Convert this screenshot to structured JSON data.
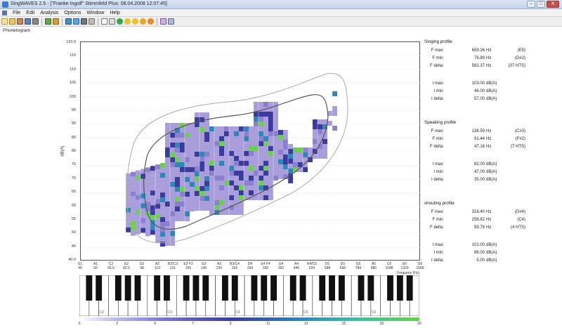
{
  "window": {
    "title": "SingWAVES 2.5 - [\"Franke Ingolf\" Stimmfeld Plus: 08.04.2008 12:07:45]",
    "min_label": "–",
    "max_label": "□",
    "close_label": "X"
  },
  "menu": [
    "File",
    "Edit",
    "Analysis",
    "Options",
    "Window",
    "Help"
  ],
  "panel": {
    "title": "Phonetogram"
  },
  "chart_data": {
    "type": "heatmap",
    "ylabel": "dB(A)",
    "xlabel": "Frequenz (Hz)",
    "y_ticks": [
      "120.0",
      "115",
      "110",
      "105",
      "100",
      "95",
      "90",
      "85",
      "80",
      "75",
      "70",
      "65",
      "60",
      "55",
      "50",
      "45",
      "40.0"
    ],
    "x_notes": [
      {
        "note": "G1",
        "hz": "49"
      },
      {
        "note": "A1",
        "hz": "55"
      },
      {
        "note": "C2",
        "hz": "65.5"
      },
      {
        "note": "E2",
        "hz": "82.5"
      },
      {
        "note": "G2",
        "hz": "98"
      },
      {
        "note": "A2",
        "hz": "110"
      },
      {
        "note": "B2/C3",
        "hz": "131"
      },
      {
        "note": "E3 F3",
        "hz": "165"
      },
      {
        "note": "G3",
        "hz": "196"
      },
      {
        "note": "A3",
        "hz": "220"
      },
      {
        "note": "B3/C4",
        "hz": "262"
      },
      {
        "note": "D4",
        "hz": "294"
      },
      {
        "note": "E4 F4",
        "hz": "330"
      },
      {
        "note": "G4",
        "hz": "392"
      },
      {
        "note": "A4",
        "hz": "440"
      },
      {
        "note": "H4/C5",
        "hz": "524"
      },
      {
        "note": "D5",
        "hz": "588"
      },
      {
        "note": "E5",
        "hz": "660"
      },
      {
        "note": "G5",
        "hz": "784"
      },
      {
        "note": "A5",
        "hz": "880"
      },
      {
        "note": "C6",
        "hz": "1048"
      },
      {
        "note": "E6",
        "hz": "1320"
      },
      {
        "note": "G6",
        "hz": "1568"
      }
    ],
    "octave_labels": [
      "C2",
      "C3",
      "C4",
      "C5",
      "C6"
    ],
    "colorbar_ticks": [
      "0",
      "2",
      "4",
      "7",
      "9",
      "11",
      "13",
      "15",
      "18",
      "20"
    ],
    "colors": {
      "low": "#a99ddc",
      "mid": "#3b3b9b",
      "high": "#2f86b8",
      "peak": "#6ccf53",
      "contour_inner": "#555555",
      "contour_outer": "#aaaaaa"
    }
  },
  "profiles": [
    {
      "title": "Singing profile",
      "rows": [
        {
          "label": "F max:",
          "value": "659.26",
          "unit": "Hz",
          "note": "(E5)"
        },
        {
          "label": "F min:",
          "value": "76.89",
          "unit": "Hz",
          "note": "(D#2)"
        },
        {
          "label": "F delta:",
          "value": "582.37",
          "unit": "Hz",
          "note": "(37 HTS)"
        },
        {
          "label": "I max:",
          "value": "103.00",
          "unit": "dB(A)",
          "note": ""
        },
        {
          "label": "I min:",
          "value": "46.00",
          "unit": "dB(A)",
          "note": ""
        },
        {
          "label": "I delta:",
          "value": "57.00",
          "unit": "dB(A)",
          "note": ""
        }
      ]
    },
    {
      "title": "Speaking  profile",
      "rows": [
        {
          "label": "F max:",
          "value": "138.59",
          "unit": "Hz",
          "note": "(C#3)"
        },
        {
          "label": "F min:",
          "value": "91.44",
          "unit": "Hz",
          "note": "(F#2)"
        },
        {
          "label": "F delta:",
          "value": "47.16",
          "unit": "Hz",
          "note": "(7 HTS)"
        },
        {
          "label": "I max:",
          "value": "82.00",
          "unit": "dB(A)",
          "note": ""
        },
        {
          "label": "I min:",
          "value": "47.00",
          "unit": "dB(A)",
          "note": ""
        },
        {
          "label": "I delta:",
          "value": "35.00",
          "unit": "dB(A)",
          "note": ""
        }
      ]
    },
    {
      "title": "shouting  profile",
      "rows": [
        {
          "label": "F max:",
          "value": "318.40",
          "unit": "Hz",
          "note": "(D#4)"
        },
        {
          "label": "F min:",
          "value": "258.62",
          "unit": "Hz",
          "note": "(C4)"
        },
        {
          "label": "F delta:",
          "value": "59.78",
          "unit": "Hz",
          "note": "(4 HTS)"
        },
        {
          "label": "I max:",
          "value": "101.00",
          "unit": "dB(A)",
          "note": ""
        },
        {
          "label": "I min:",
          "value": "96.00",
          "unit": "dB(A)",
          "note": ""
        },
        {
          "label": "I delta:",
          "value": "5.00",
          "unit": "dB(A)",
          "note": ""
        }
      ]
    }
  ]
}
